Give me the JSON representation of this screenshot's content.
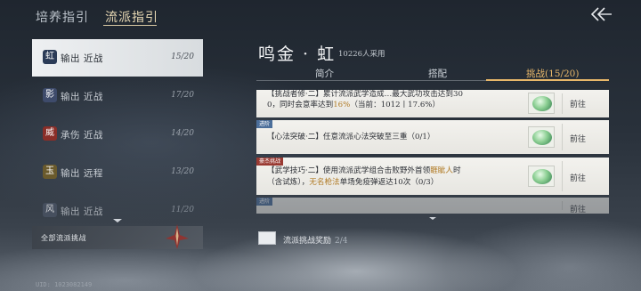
{
  "top_tabs": [
    {
      "label": "培养指引",
      "active": false
    },
    {
      "label": "流派指引",
      "active": true
    }
  ],
  "back_icon": "double-chevron-left-icon",
  "sidebar": {
    "items": [
      {
        "badge": "虹",
        "badge_color": "#2b3b57",
        "label": "输出 近战",
        "count": "15/20",
        "active": true
      },
      {
        "badge": "影",
        "badge_color": "#3e4b6b",
        "label": "输出 近战",
        "count": "17/20",
        "active": false
      },
      {
        "badge": "威",
        "badge_color": "#8a2e28",
        "label": "承伤 近战",
        "count": "14/20",
        "active": false
      },
      {
        "badge": "玉",
        "badge_color": "#6a5a2c",
        "label": "输出 远程",
        "count": "13/20",
        "active": false
      },
      {
        "badge": "风",
        "badge_color": "#4b5565",
        "label": "输出 近战",
        "count": "11/20",
        "active": false
      }
    ],
    "all_label": "全部流派挑战",
    "uid": "UID: 1023082149"
  },
  "header": {
    "title": "鸣金 · 虹",
    "users": "10226人采用",
    "tabs": [
      {
        "label": "简介",
        "active": false
      },
      {
        "label": "搭配",
        "active": false
      },
      {
        "label": "挑战(15/20)",
        "active": true
      }
    ]
  },
  "tasks": [
    {
      "tag": "",
      "line1": "【挑战者修·二】累计流派武学造成…最大武功攻击达到30",
      "line2a": "0，同时会意率达到",
      "line2b": "16%",
      "line2c": "（当前：1012丨17.6%）",
      "go": "前往"
    },
    {
      "tag": "进阶",
      "line1": "【心法突破·二】任意流派心法突破至三重（0/1）",
      "go": "前往"
    },
    {
      "tag": "豪杰挑战",
      "line1a": "【武学技巧·二】使用流派武学组合击败野外首领",
      "line1b": "睚眦人",
      "line1c": "时",
      "line2a": "（含试炼），",
      "line2b": "无名枪法",
      "line2c": "单场免疫弹返达10次（0/3）",
      "go": "前往"
    },
    {
      "tag": "进阶",
      "go": "前往"
    }
  ],
  "bottom": {
    "label": "流派挑战奖励",
    "count": "2/4"
  }
}
